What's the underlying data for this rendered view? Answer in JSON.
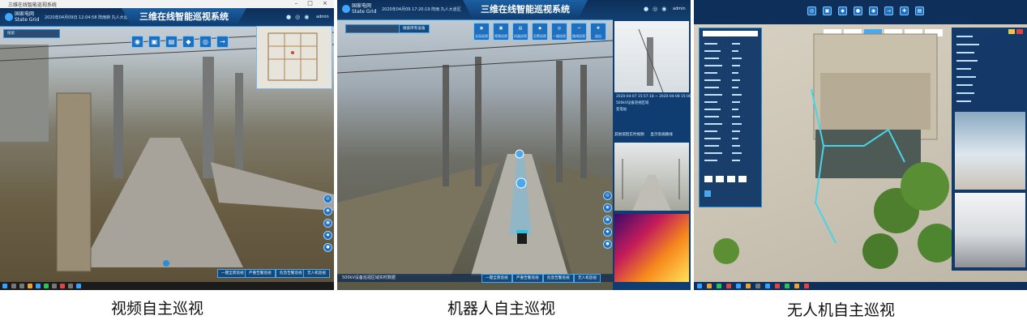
{
  "panel_video": {
    "window_title": "三维在线智能巡视系统",
    "brand": "国家电网 State Grid",
    "datetime": "2020年04月09日 12:04:58",
    "weather": "阵雨转 丸人大道区",
    "app_title": "三维在线智能巡视系统",
    "user": "admin",
    "search_placeholder": "搜索",
    "bottom_buttons": [
      "一键全景巡视",
      "严重告警巡视",
      "危急告警巡视",
      "无人机巡视"
    ],
    "caption": "视频自主巡视"
  },
  "panel_robot": {
    "brand": "国家电网 State Grid",
    "datetime": "2020年04月09 17:20:19",
    "weather": "阵雨 丸人大道区",
    "app_title": "三维在线智能巡视系统",
    "user": "admin",
    "search_button": "搜索所有设备",
    "toolbar": [
      {
        "icon": "◉",
        "label": "全局巡视"
      },
      {
        "icon": "▣",
        "label": "视频巡视"
      },
      {
        "icon": "▤",
        "label": "机器巡视"
      },
      {
        "icon": "◆",
        "label": "告警巡视"
      },
      {
        "icon": "◎",
        "label": "一键巡视"
      },
      {
        "icon": "→",
        "label": "路线巡视"
      },
      {
        "icon": "✚",
        "label": "退出"
      }
    ],
    "right_info": {
      "time_range": "2020-04-07 15:57:18 ~ 2020-04-08 15:00:10",
      "device": "500kV设备巡视区域",
      "detail": "变电站"
    },
    "right_panel_title": "其他巡检实时视频",
    "right_panel_toggle": "显示巡视路线",
    "status_text": "500kV设备巡视区域实时数据",
    "bottom_buttons": [
      "一键全景巡视",
      "严重告警巡视",
      "危急告警巡视",
      "无人机巡视"
    ],
    "caption": "机器人自主巡视"
  },
  "panel_drone": {
    "caption": "无人机自主巡视"
  },
  "colors": {
    "header": "#0d2f5a",
    "accent": "#2a8fd6",
    "panel_bg": "#0f3d72"
  }
}
